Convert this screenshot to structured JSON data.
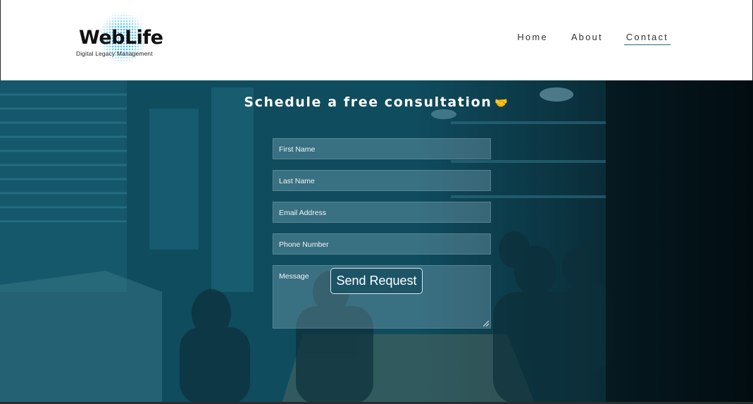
{
  "logo": {
    "brand": "WebLife",
    "tagline": "Digital Legacy Management",
    "accent": "#3bb8e6"
  },
  "nav": {
    "items": [
      {
        "label": "Home",
        "active": false
      },
      {
        "label": "About",
        "active": false
      },
      {
        "label": "Contact",
        "active": true
      }
    ]
  },
  "hero": {
    "title": "Schedule a free consultation",
    "title_icon": "handshake-icon",
    "title_icon_glyph": "🤝",
    "overlay_color": "#0f4c5e"
  },
  "form": {
    "fields": [
      {
        "name": "first-name-field",
        "placeholder": "First Name"
      },
      {
        "name": "last-name-field",
        "placeholder": "Last Name"
      },
      {
        "name": "email-field",
        "placeholder": "Email Address"
      },
      {
        "name": "phone-field",
        "placeholder": "Phone Number"
      },
      {
        "name": "message-field",
        "placeholder": "Message"
      }
    ],
    "submit_label": "Send Request"
  }
}
